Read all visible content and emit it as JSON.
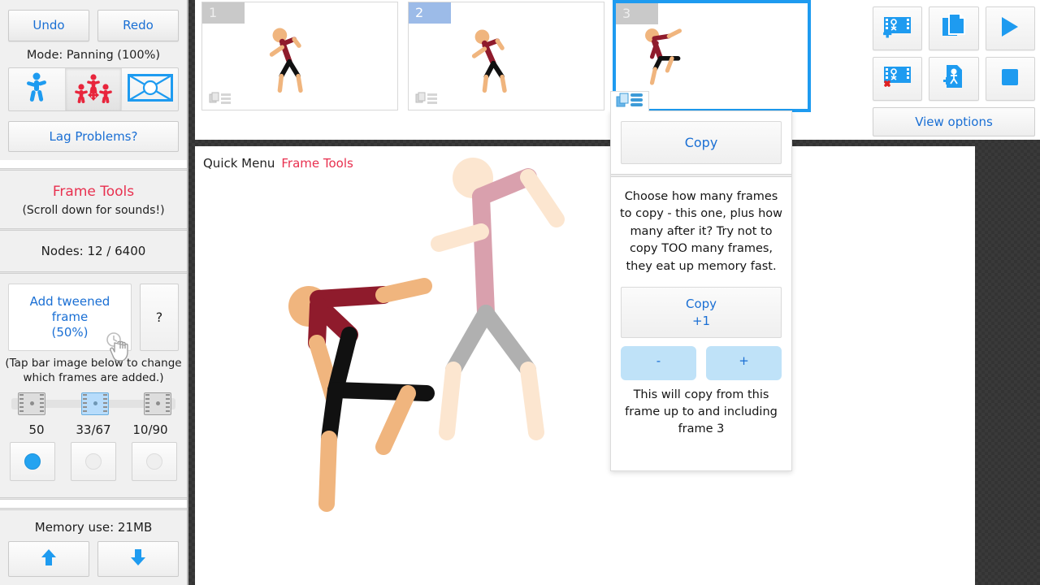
{
  "app": {
    "mode_label": "Mode: Panning (100%)"
  },
  "sidebar": {
    "undo_label": "Undo",
    "redo_label": "Redo",
    "mode_label": "Mode: Panning (100%)",
    "mode_buttons": [
      {
        "name": "single-figure-mode",
        "icon": "walking-person-icon",
        "active": false
      },
      {
        "name": "multi-figure-mode",
        "icon": "multiple-people-icon",
        "active": true
      },
      {
        "name": "background-mode",
        "icon": "framed-scene-icon",
        "active": false
      }
    ],
    "lag_label": "Lag Problems?",
    "frame_tools_title": "Frame Tools",
    "frame_tools_sub": "(Scroll down for sounds!)",
    "nodes_label": "Nodes: 12 / 6400",
    "tween_label": "Add tweened frame",
    "tween_percent": "(50%)",
    "help_label": "?",
    "tap_note": "(Tap bar image below to change which frames are added.)",
    "tween_options": [
      {
        "label": "50",
        "selected": true
      },
      {
        "label": "33/67",
        "selected": false
      },
      {
        "label": "10/90",
        "selected": false
      }
    ],
    "strip_selected_index": 1,
    "memory_label": "Memory use: 21MB",
    "scroll_up_icon": "arrow-up-icon",
    "scroll_down_icon": "arrow-down-icon"
  },
  "filmstrip": {
    "frames": [
      {
        "number": "1",
        "selected": false,
        "current": false,
        "menu_icon": "frame-menu-icon"
      },
      {
        "number": "2",
        "selected": false,
        "current": true,
        "menu_icon": "frame-menu-icon"
      },
      {
        "number": "3",
        "selected": true,
        "current": false,
        "menu_icon": "frame-menu-icon"
      }
    ]
  },
  "right_toolbar": {
    "buttons": [
      {
        "name": "add-frame-button",
        "icon": "film-plus-icon"
      },
      {
        "name": "copy-frame-button",
        "icon": "copy-pages-icon"
      },
      {
        "name": "play-button",
        "icon": "play-icon"
      },
      {
        "name": "delete-frame-button",
        "icon": "film-delete-icon"
      },
      {
        "name": "add-figure-button",
        "icon": "page-figure-plus-icon"
      },
      {
        "name": "stop-button",
        "icon": "stop-icon"
      }
    ],
    "view_options_label": "View options"
  },
  "canvas": {
    "quick_menu_label": "Quick Menu",
    "frame_tools_label": "Frame Tools"
  },
  "popup": {
    "tab_icon": "frame-menu-icon",
    "copy_label": "Copy",
    "description": "Choose how many frames to copy - this one, plus how many after it? Try not to copy TOO many frames, they eat up memory fast.",
    "copy_plus_label": "Copy",
    "copy_plus_count": "+1",
    "minus_label": "-",
    "plus_label": "+",
    "note": "This will copy from this frame up to and including frame 3"
  },
  "colors": {
    "accent_blue": "#1a6fd4",
    "frame_selected": "#1e9bf0",
    "title_red": "#e8304f",
    "skin": "#f0b57e",
    "torso_red": "#8f1b2c",
    "leg_black": "#111111",
    "ghost_skin": "#fce6d0",
    "ghost_red": "#d9a0ad",
    "ghost_grey": "#b0b0b0"
  }
}
